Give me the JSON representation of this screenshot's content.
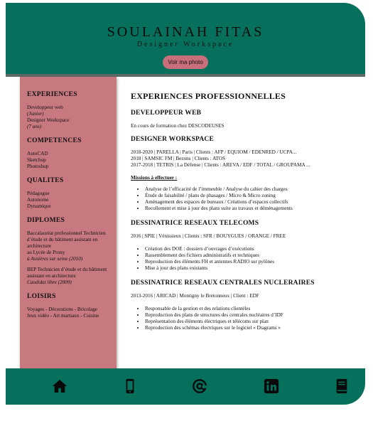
{
  "header": {
    "name": "SOULAINAH FITAS",
    "subtitle": "Designer Workspace",
    "photo_button": "Voir ma photo"
  },
  "sidebar": {
    "experiences": {
      "title": "EXPERIENCES",
      "lines": [
        "Developpeur web",
        "(Junior)",
        "Designer Workspace",
        "(7 ans)"
      ]
    },
    "competences": {
      "title": "COMPETENCES",
      "lines": [
        "AutoCAD",
        "Sketchup",
        "Photoshop"
      ]
    },
    "qualites": {
      "title": "QUALITES",
      "lines": [
        "Pédagogue",
        "Autonome",
        "Dynamique"
      ]
    },
    "diplomes": {
      "title": "DIPLOMES",
      "d1": [
        "Baccalauréat professionnel Technicien",
        "d’étude et du bâtiment assistant en",
        "architecture",
        "au Lycée de Prony",
        "à Asnières sur seine (2010)"
      ],
      "d2": [
        "BEP Technicien d’étude et du bâtiment",
        "assistant en architecture",
        "Candidat libre (2009)"
      ]
    },
    "loisirs": {
      "title": "LOISIRS",
      "lines": [
        "Voyages - Décorations - Bricolage",
        "Jeux vidéo - Art martiaux - Cuisine"
      ]
    }
  },
  "main": {
    "title": "EXPERIENCES PROFESSIONNELLES",
    "dev": {
      "title": "DEVELOPPEUR WEB",
      "lines": [
        "En cours de formation chez DESCODEUSES"
      ]
    },
    "designer": {
      "title": "DESIGNER WORKSPACE",
      "lines": [
        "2018-2020 | PARELLA | Paris | Clients : AFP / EQUIOM / EDENRED / UCPA...",
        "2018 | SAMSIC FM | Bezons | Clients : ATOS",
        "2017-2018 | TETRIS | La Défense | Clients : AREVA / EDF / TOTAL / GROUPAMA ..."
      ],
      "missions_label": "Missions à effectuer :",
      "bullets": [
        "Analyse de l’efficacité de l’immeuble / Analyse du cahier des charges",
        "Étude de faisabilité / plans de phasages / Micro & Micro zoning",
        "Aménagement des espaces de bureaux / Créations d’espaces collectifs",
        "Recollement et mise à jour des plans suite au travaux et déménagements"
      ]
    },
    "telecoms": {
      "title": "DESSINATRICE RESEAUX TELECOMS",
      "line": "2016 | SPIE | Vénissieux | Clients : SFR / BOUYGUES / ORANGE / FREE",
      "bullets": [
        "Création des DOE : dossiers d’ouvrages d’exécutions",
        "Rassemblement des fichiers administratifs et techniques",
        "Reproduction des éléments FH et antennes RADIO sur pylônes",
        "Mise à jour des plans existants"
      ]
    },
    "nucleaires": {
      "title": "DESSINATRICE RESEAUX CENTRALES NUCLERAIRES",
      "line": "2013-2016 | ARICAD | Montigny le Bretonneux | Client : EDF",
      "bullets": [
        "Responsable de la gestion et des relations clientèles",
        "Reproduction des plans de structures des centrales nucléaires d’IDF",
        "Représentation des éléments électriques et télécoms sur plan",
        "Reproduction des schémas électriques sur le logiciel « Diagrams »"
      ]
    }
  },
  "footer": {
    "icons": [
      "home-icon",
      "mobile-phone-icon",
      "at-sign-icon",
      "linkedin-icon",
      "book-icon"
    ]
  },
  "colors": {
    "green": "#07705c",
    "rose_sidebar": "#c7797f",
    "rose_button": "#c96f7a"
  }
}
